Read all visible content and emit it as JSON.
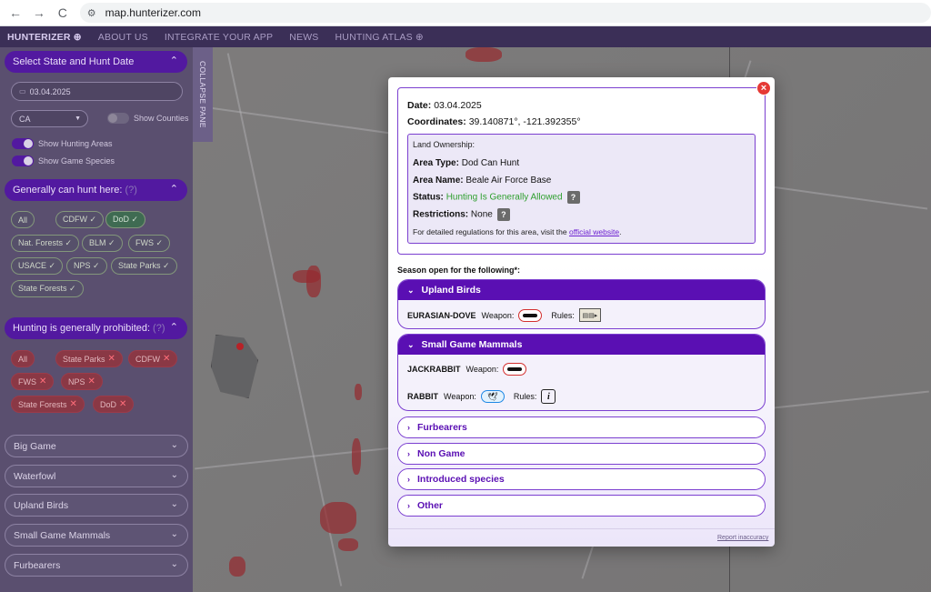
{
  "browser": {
    "url": "map.hunterizer.com",
    "back_icon": "←",
    "forward_icon": "→",
    "reload_icon": "C"
  },
  "site_nav": {
    "brand": "HUNTERIZER ⊕",
    "links": [
      "ABOUT US",
      "INTEGRATE YOUR APP",
      "NEWS",
      "HUNTING ATLAS ⊕"
    ]
  },
  "sidebar": {
    "select_header": "Select State and Hunt Date",
    "date_value": "03.04.2025",
    "state_value": "CA",
    "show_counties": "Show Counties",
    "show_hunting_areas": "Show Hunting Areas",
    "show_game_species": "Show Game Species",
    "collapse_pane": "COLLAPSE PANE",
    "can_hunt_header": "Generally can hunt here:",
    "can_hunt_hint": "(?)",
    "can_hunt_chips": [
      "All",
      "CDFW ✓",
      "DoD ✓",
      "Nat. Forests ✓",
      "BLM ✓",
      "FWS ✓",
      "USACE ✓",
      "NPS ✓",
      "State Parks ✓",
      "State Forests ✓"
    ],
    "prohibited_header": "Hunting is generally prohibited:",
    "prohibited_hint": "(?)",
    "prohibited_chips": [
      "All",
      "State Parks",
      "CDFW",
      "FWS",
      "NPS",
      "State Forests",
      "DoD"
    ],
    "categories": [
      "Big Game",
      "Waterfowl",
      "Upland Birds",
      "Small Game Mammals",
      "Furbearers"
    ]
  },
  "modal": {
    "date_label": "Date:",
    "date_value": "03.04.2025",
    "coords_label": "Coordinates:",
    "coords_value": "39.140871°, -121.392355°",
    "land_title": "Land Ownership:",
    "area_type_label": "Area Type:",
    "area_type_value": "Dod Can Hunt",
    "area_name_label": "Area Name:",
    "area_name_value": "Beale Air Force Base",
    "status_label": "Status:",
    "status_value": "Hunting Is Generally Allowed",
    "restrictions_label": "Restrictions:",
    "restrictions_value": "None",
    "help_glyph": "?",
    "note_prefix": "For detailed regulations for this area, visit the ",
    "note_link": "official website",
    "note_suffix": ".",
    "season_label": "Season open for the following*:",
    "upland_birds": "Upland Birds",
    "upland_species": [
      {
        "name": "EURASIAN-DOVE",
        "weapon_label": "Weapon:",
        "rules_label": "Rules:"
      }
    ],
    "small_game": "Small Game Mammals",
    "small_species": [
      {
        "name": "JACKRABBIT",
        "weapon_label": "Weapon:"
      },
      {
        "name": "RABBIT",
        "weapon_label": "Weapon:",
        "rules_label": "Rules:"
      }
    ],
    "closed_categories": [
      "Furbearers",
      "Non Game",
      "Introduced species",
      "Other"
    ],
    "report": "Report inaccuracy"
  }
}
